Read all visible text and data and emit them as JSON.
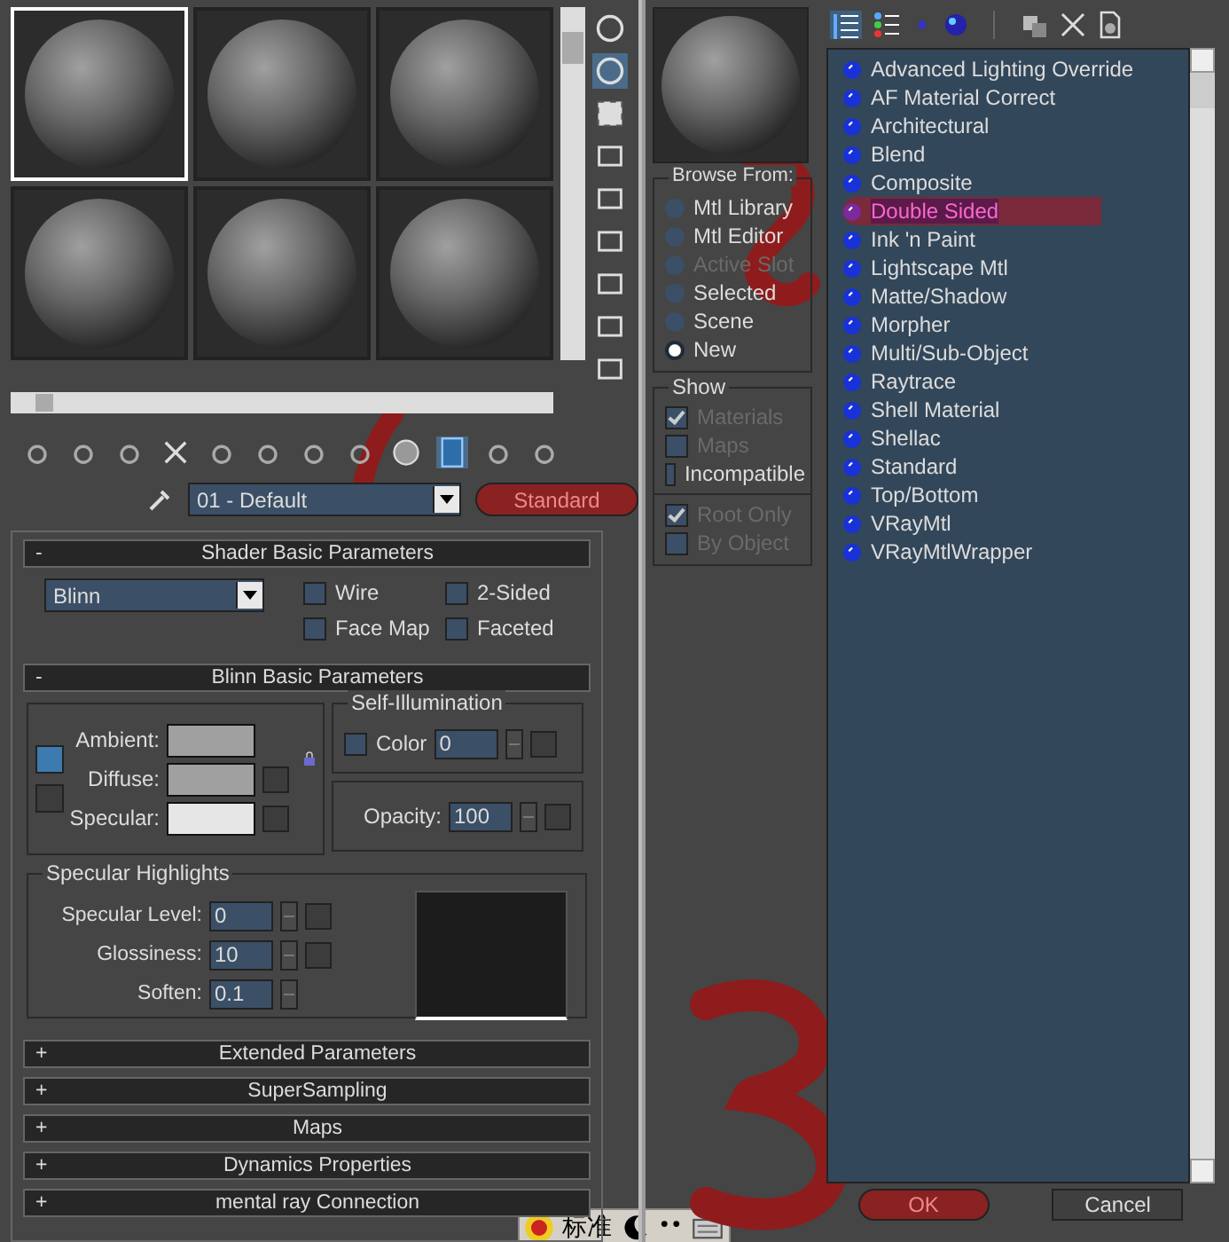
{
  "sample_slots": [
    {
      "selected": true
    },
    {
      "selected": false
    },
    {
      "selected": false
    },
    {
      "selected": false
    },
    {
      "selected": false
    },
    {
      "selected": false
    }
  ],
  "material_name": "01 - Default",
  "material_type_button": {
    "label": "Standard",
    "highlighted": true
  },
  "shader_rollout": {
    "toggle": "-",
    "title": "Shader Basic Parameters",
    "shader": "Blinn",
    "options": [
      {
        "label": "Wire",
        "checked": false
      },
      {
        "label": "2-Sided",
        "checked": false
      },
      {
        "label": "Face Map",
        "checked": false
      },
      {
        "label": "Faceted",
        "checked": false
      }
    ]
  },
  "blinn_rollout": {
    "toggle": "-",
    "title": "Blinn Basic Parameters",
    "colors": [
      {
        "label": "Ambient:",
        "color": "#a0a0a0"
      },
      {
        "label": "Diffuse:",
        "color": "#a0a0a0"
      },
      {
        "label": "Specular:",
        "color": "#e6e6e6"
      }
    ],
    "self_illumination": {
      "title": "Self-Illumination",
      "label": "Color",
      "checked": false,
      "value": "0"
    },
    "opacity": {
      "label": "Opacity:",
      "value": "100"
    },
    "specular_highlights": {
      "title": "Specular Highlights",
      "fields": [
        {
          "label": "Specular Level:",
          "value": "0"
        },
        {
          "label": "Glossiness:",
          "value": "10"
        },
        {
          "label": "Soften:",
          "value": "0.1"
        }
      ]
    }
  },
  "collapsed_rollouts": [
    {
      "toggle": "+",
      "title": "Extended Parameters"
    },
    {
      "toggle": "+",
      "title": "SuperSampling"
    },
    {
      "toggle": "+",
      "title": "Maps"
    },
    {
      "toggle": "+",
      "title": "Dynamics Properties"
    },
    {
      "toggle": "+",
      "title": "mental ray Connection"
    }
  ],
  "ime_bar": {
    "mode": "标准"
  },
  "browser": {
    "browse_from": {
      "title": "Browse From:",
      "options": [
        {
          "label": "Mtl Library",
          "selected": false,
          "disabled": false
        },
        {
          "label": "Mtl Editor",
          "selected": false,
          "disabled": false
        },
        {
          "label": "Active Slot",
          "selected": false,
          "disabled": true
        },
        {
          "label": "Selected",
          "selected": false,
          "disabled": false
        },
        {
          "label": "Scene",
          "selected": false,
          "disabled": false
        },
        {
          "label": "New",
          "selected": true,
          "disabled": false
        }
      ]
    },
    "show": {
      "title": "Show",
      "options": [
        {
          "label": "Materials",
          "checked": true,
          "disabled": true
        },
        {
          "label": "Maps",
          "checked": false,
          "disabled": true
        },
        {
          "label": "Incompatible",
          "checked": false,
          "disabled": false
        }
      ]
    },
    "filters": [
      {
        "label": "Root Only",
        "checked": true,
        "disabled": true
      },
      {
        "label": "By Object",
        "checked": false,
        "disabled": true
      }
    ],
    "materials": [
      {
        "label": "Advanced Lighting Override",
        "selected": false,
        "highlighted": false
      },
      {
        "label": "AF Material Correct",
        "selected": false,
        "highlighted": false
      },
      {
        "label": "Architectural",
        "selected": false,
        "highlighted": false
      },
      {
        "label": "Blend",
        "selected": false,
        "highlighted": false
      },
      {
        "label": "Composite",
        "selected": false,
        "highlighted": false
      },
      {
        "label": "Double Sided",
        "selected": true,
        "highlighted": true
      },
      {
        "label": "Ink 'n Paint",
        "selected": false,
        "highlighted": false
      },
      {
        "label": "Lightscape Mtl",
        "selected": false,
        "highlighted": false
      },
      {
        "label": "Matte/Shadow",
        "selected": false,
        "highlighted": false
      },
      {
        "label": "Morpher",
        "selected": false,
        "highlighted": false
      },
      {
        "label": "Multi/Sub-Object",
        "selected": false,
        "highlighted": false
      },
      {
        "label": "Raytrace",
        "selected": false,
        "highlighted": false
      },
      {
        "label": "Shell Material",
        "selected": false,
        "highlighted": false
      },
      {
        "label": "Shellac",
        "selected": false,
        "highlighted": false
      },
      {
        "label": "Standard",
        "selected": false,
        "highlighted": false
      },
      {
        "label": "Top/Bottom",
        "selected": false,
        "highlighted": false
      },
      {
        "label": "VRayMtl",
        "selected": false,
        "highlighted": false
      },
      {
        "label": "VRayMtlWrapper",
        "selected": false,
        "highlighted": false
      }
    ],
    "buttons": [
      {
        "label": "OK",
        "highlighted": true
      },
      {
        "label": "Cancel",
        "highlighted": false
      }
    ]
  }
}
